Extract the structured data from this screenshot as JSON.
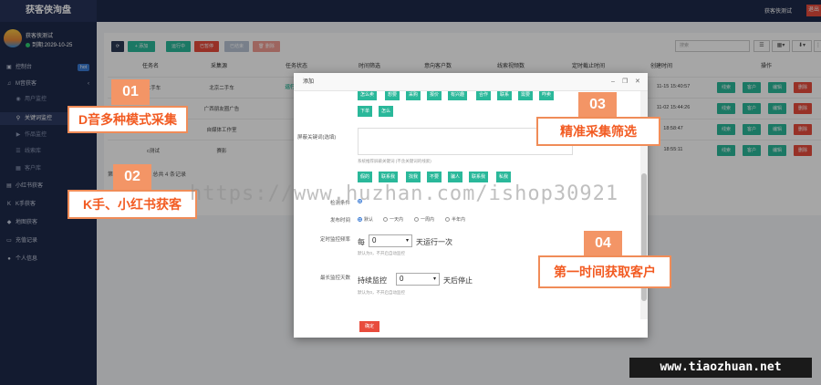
{
  "app": {
    "title": "获客侠洵盘",
    "top_user": "获客侠测试",
    "exit_label": "退出"
  },
  "profile": {
    "name": "获客侠测试",
    "expiry": "到期:2029-10-25"
  },
  "sidebar": {
    "items": [
      {
        "label": "控制台",
        "icon": "monitor-icon",
        "badge": "hot"
      },
      {
        "label": "M音获客",
        "icon": "music-icon",
        "arrow": "‹"
      },
      {
        "label": "用户监控",
        "icon": "eye-icon"
      },
      {
        "label": "关键词监控",
        "icon": "search-icon"
      },
      {
        "label": "作品监控",
        "icon": "video-icon"
      },
      {
        "label": "线索库",
        "icon": "list-icon"
      },
      {
        "label": "客户库",
        "icon": "users-icon"
      },
      {
        "label": "小红书获客",
        "icon": "book-icon"
      },
      {
        "label": "K手获客",
        "icon": "k-icon"
      },
      {
        "label": "地图获客",
        "icon": "map-pin-icon"
      },
      {
        "label": "充值记录",
        "icon": "card-icon"
      },
      {
        "label": "个人信息",
        "icon": "person-icon"
      }
    ]
  },
  "toolbar": {
    "refresh": "⟳",
    "add": "+ 添加",
    "run": "运行中",
    "stop": "已暂停",
    "finished": "已结束",
    "delete": "🗑 删除",
    "search_placeholder": "搜索"
  },
  "table": {
    "headers": [
      "任务名",
      "采集源",
      "任务状态",
      "时间筛选",
      "意向客户数",
      "线索视频数",
      "定时截止时间",
      "创建时间",
      "操作"
    ],
    "rows": [
      {
        "name": "二手车",
        "source": "北京二手车",
        "status": "运行",
        "created": "11-15 15:40:57"
      },
      {
        "name": "",
        "source": "广西朋友圈广告",
        "status": "",
        "created": "11-02 15:44:26"
      },
      {
        "name": "",
        "source": "自媒体工作室",
        "status": "",
        "created": "18:58:47"
      },
      {
        "name": "c测试",
        "source": "赛影",
        "status": "",
        "created": "18:55:11"
      }
    ],
    "actions": [
      "线索",
      "客户",
      "编辑",
      "删除"
    ],
    "summary": "第 1 到 4 条记录，总共 4 条记录"
  },
  "modal": {
    "title": "添加",
    "controls": [
      "–",
      "❐",
      "✕"
    ],
    "top_tags": [
      "怎么卖",
      "想要",
      "采购",
      "报价",
      "有兴趣",
      "合作",
      "联系",
      "需要",
      "咋卖",
      "下单",
      "怎么"
    ],
    "exclude_label": "屏蔽关键词(选填)",
    "exclude_hint": "(不含关键词的线索)",
    "recommend_label": "系统推荐屏蔽关键词",
    "exclude_tags": [
      "假的",
      "联系我",
      "找我",
      "不要",
      "骗人",
      "联系我",
      "私我"
    ],
    "row_label": "检测条件",
    "time_label": "发布时间",
    "time_options": [
      "默认",
      "一天内",
      "一周内",
      "半年内"
    ],
    "monitor_label": "定时监控频率",
    "monitor_prefix": "每",
    "monitor_value": "0",
    "monitor_suffix": "天运行一次",
    "monitor_hint": "默认为0，不开启自动监控",
    "deadline_label": "最长监控天数",
    "deadline_prefix": "持续监控",
    "deadline_value": "0",
    "deadline_suffix": "天后停止",
    "deadline_hint": "默认为0，不开启自动监控",
    "confirm": "确定"
  },
  "callouts": [
    {
      "num": "01",
      "text": "D音多种模式采集"
    },
    {
      "num": "02",
      "text": "K手、小红书获客"
    },
    {
      "num": "03",
      "text": "精准采集筛选"
    },
    {
      "num": "04",
      "text": "第一时间获取客户"
    }
  ],
  "watermark": "https://www.huzhan.com/ishop30921",
  "site_mark": "www.tiaozhuan.net",
  "colors": {
    "nav_bg": "#1e2a4a",
    "teal": "#2ab89a",
    "red": "#e84c3d",
    "orange": "#f08c58"
  }
}
